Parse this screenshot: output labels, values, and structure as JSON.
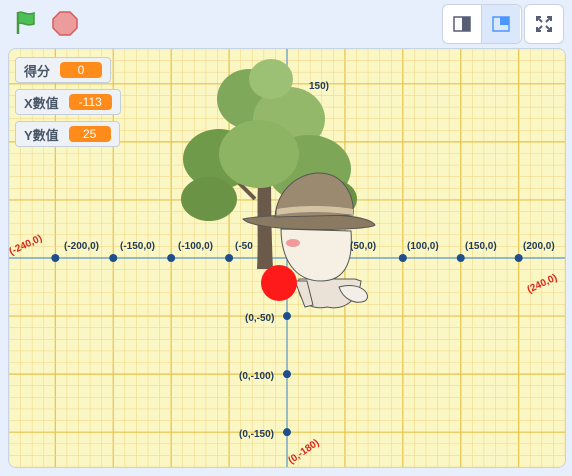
{
  "controls": {
    "green_flag_icon": "green-flag-icon",
    "stop_icon": "stop-sign-icon",
    "small_stage_icon": "small-stage-layout-icon",
    "normal_stage_icon": "normal-stage-layout-icon",
    "fullscreen_icon": "fullscreen-icon"
  },
  "monitors": [
    {
      "label": "得分",
      "value": "0"
    },
    {
      "label": "X數值",
      "value": "-113"
    },
    {
      "label": "Y數值",
      "value": "25"
    }
  ],
  "stage": {
    "background": "#fbf7c4",
    "grid_minor": "#f0d98a",
    "grid_major": "#e6c24a",
    "axis_color": "#5b9bd5",
    "point_color": "#1f4e8c",
    "corner_label_color": "#d9261c",
    "x_axis_labels": [
      "(-200,0)",
      "(-150,0)",
      "(-100,0)",
      "(-50",
      "(50,0)",
      "(100,0)",
      "(150,0)",
      "(200,0)"
    ],
    "y_axis_labels": [
      "(0,-50)",
      "(0,-100)",
      "(0,-150)"
    ],
    "top_label": "150)",
    "corner_labels": {
      "left": "(-240,0)",
      "right": "(240,0)",
      "bottom": "(0,-180)"
    },
    "ball_color": "#ff1a1a",
    "sprites": [
      "tree",
      "girl-with-hat"
    ]
  }
}
